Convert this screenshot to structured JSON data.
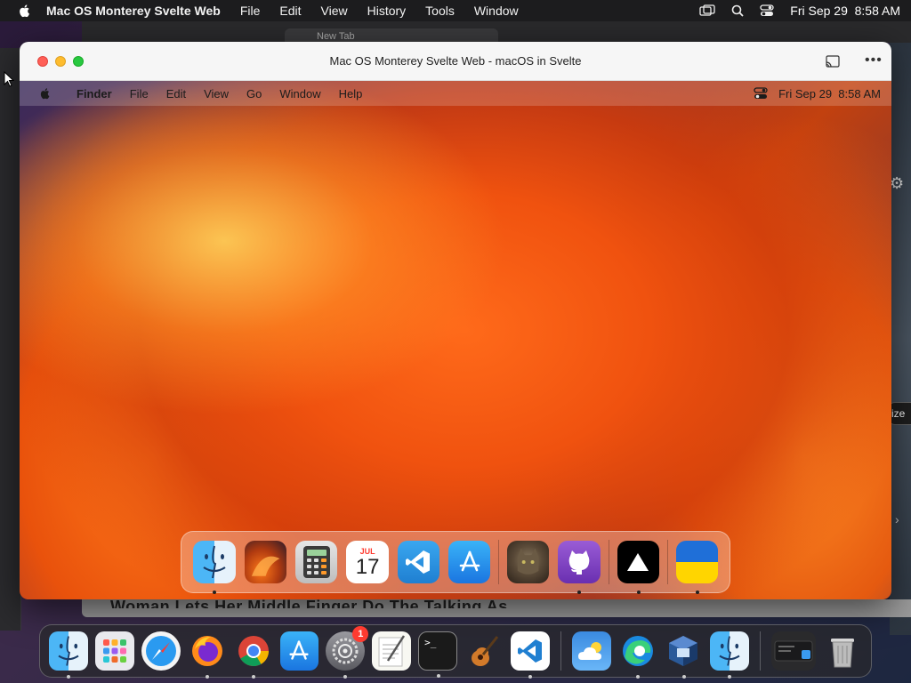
{
  "host_menubar": {
    "app_name": "Mac OS Monterey Svelte Web",
    "menus": [
      "File",
      "Edit",
      "View",
      "History",
      "Tools",
      "Window"
    ],
    "clock": "Fri Sep 29  8:58 AM"
  },
  "window": {
    "title": "Mac OS Monterey Svelte Web - macOS in Svelte"
  },
  "background_browser": {
    "tab_label": "New Tab",
    "size_label": "ize",
    "caption": "Woman Lets Her Middle Finger Do The Talking As"
  },
  "inner_menubar": {
    "menus": [
      "Finder",
      "File",
      "Edit",
      "View",
      "Go",
      "Window",
      "Help"
    ],
    "clock": "Fri Sep 29  8:58 AM"
  },
  "inner_dock": {
    "calendar_month": "JUL",
    "calendar_day": "17",
    "apps": [
      {
        "name": "Finder",
        "running": true
      },
      {
        "name": "Wallpapers",
        "running": false
      },
      {
        "name": "Calculator",
        "running": false
      },
      {
        "name": "Calendar",
        "running": false
      },
      {
        "name": "VS Code",
        "running": false
      },
      {
        "name": "App Store",
        "running": false
      },
      {
        "name": "Cat Photo",
        "running": false
      },
      {
        "name": "GitHub",
        "running": true
      },
      {
        "name": "Vercel",
        "running": true
      },
      {
        "name": "Ukraine",
        "running": true
      }
    ]
  },
  "host_dock": {
    "system_settings_badge": "1",
    "terminal_prompt": ">_"
  },
  "colors": {
    "accent_red": "#ff5f57",
    "accent_yellow": "#febc2e",
    "accent_green": "#28c840",
    "badge_red": "#ff3b30"
  }
}
